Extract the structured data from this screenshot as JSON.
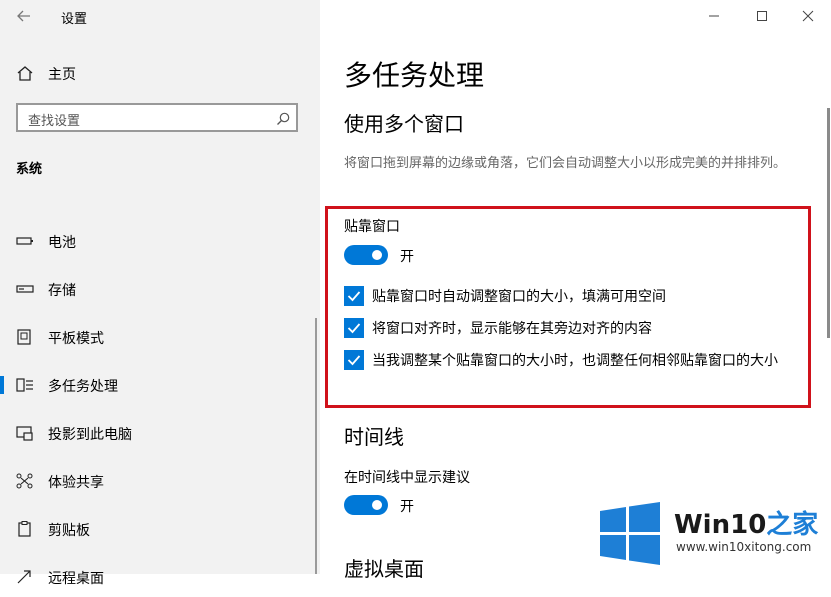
{
  "window": {
    "title": "设置"
  },
  "sidebar": {
    "home_label": "主页",
    "search_placeholder": "查找设置",
    "section_label": "系统",
    "items": [
      {
        "label": "电池",
        "icon": "battery-icon"
      },
      {
        "label": "存储",
        "icon": "storage-icon"
      },
      {
        "label": "平板模式",
        "icon": "tablet-mode-icon"
      },
      {
        "label": "多任务处理",
        "icon": "multitasking-icon",
        "active": true
      },
      {
        "label": "投影到此电脑",
        "icon": "project-icon"
      },
      {
        "label": "体验共享",
        "icon": "share-icon"
      },
      {
        "label": "剪贴板",
        "icon": "clipboard-icon"
      },
      {
        "label": "远程桌面",
        "icon": "remote-desktop-icon"
      }
    ]
  },
  "main": {
    "title": "多任务处理",
    "snap": {
      "heading": "使用多个窗口",
      "description": "将窗口拖到屏幕的边缘或角落，它们会自动调整大小以形成完美的并排排列。",
      "label": "贴靠窗口",
      "toggle_state": "开",
      "options": [
        "贴靠窗口时自动调整窗口的大小，填满可用空间",
        "将窗口对齐时，显示能够在其旁边对齐的内容",
        "当我调整某个贴靠窗口的大小时，也调整任何相邻贴靠窗口的大小"
      ]
    },
    "timeline": {
      "heading": "时间线",
      "label": "在时间线中显示建议",
      "toggle_state": "开"
    },
    "virtual_desktops": {
      "heading": "虚拟桌面"
    }
  },
  "watermark": {
    "brand_a": "Win10",
    "brand_b": "之家",
    "url": "www.win10xitong.com",
    "colors": {
      "blue": "#1e7fd6"
    }
  },
  "colors": {
    "accent": "#0078d7",
    "highlight_border": "#d0121b"
  }
}
